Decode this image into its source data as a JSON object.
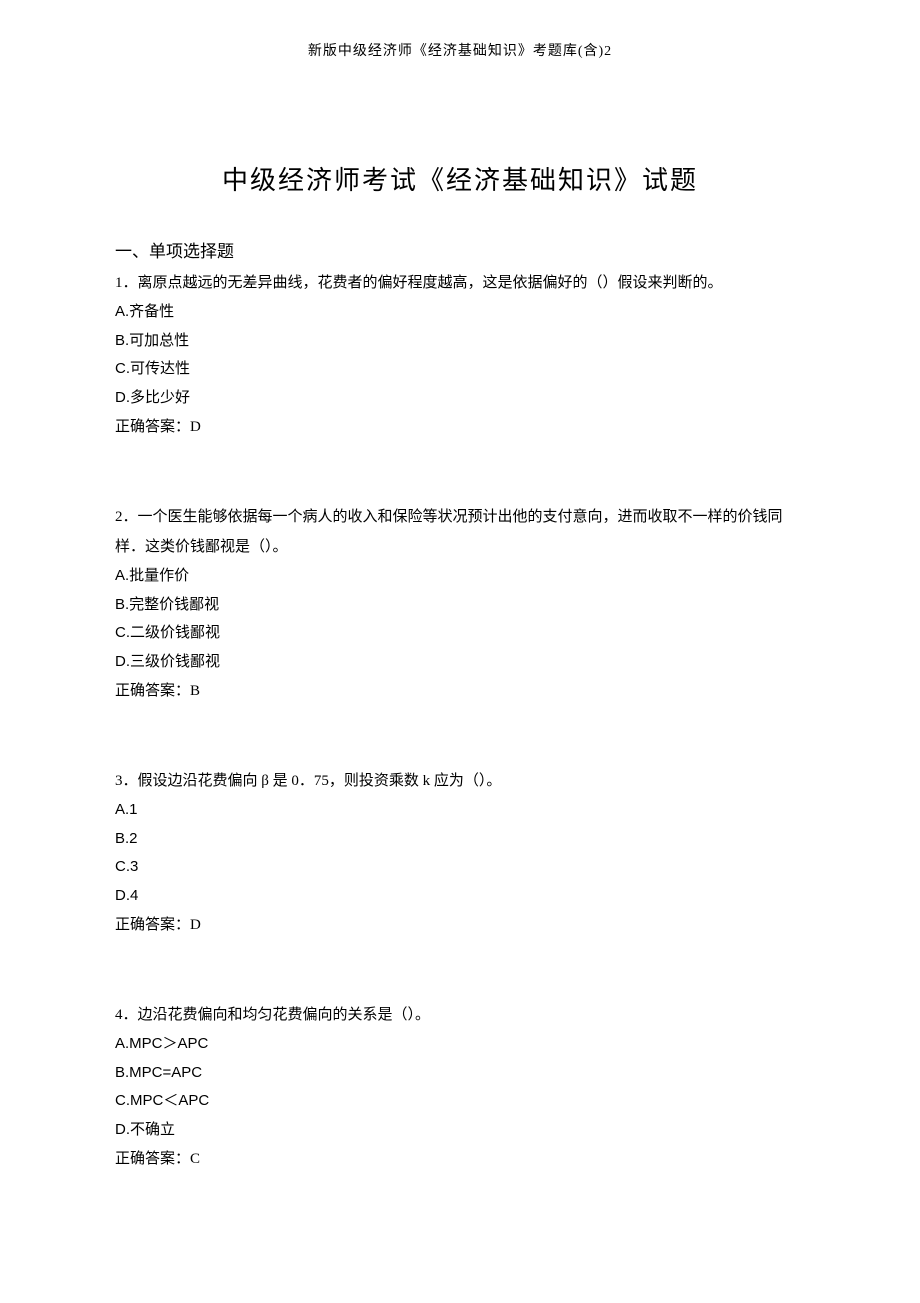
{
  "header": "新版中级经济师《经济基础知识》考题库(含)2",
  "title": "中级经济师考试《经济基础知识》试题",
  "section_heading": "一、单项选择题",
  "questions": [
    {
      "text": "1．离原点越远的无差异曲线，花费者的偏好程度越高，这是依据偏好的（）假设来判断的。",
      "options": [
        "A.齐备性",
        "B.可加总性",
        "C.可传达性",
        "D.多比少好"
      ],
      "answer": "正确答案：D"
    },
    {
      "text": "2．一个医生能够依据每一个病人的收入和保险等状况预计出他的支付意向，进而收取不一样的价钱同样．这类价钱鄙视是（）。",
      "options": [
        "A.批量作价",
        "B.完整价钱鄙视",
        "C.二级价钱鄙视",
        "D.三级价钱鄙视"
      ],
      "answer": "正确答案：B"
    },
    {
      "text": "3．假设边沿花费偏向 β 是 0．75，则投资乘数 k 应为（）。",
      "options": [
        "A.1",
        "B.2",
        "C.3",
        "D.4"
      ],
      "answer": "正确答案：D"
    },
    {
      "text": "4．边沿花费偏向和均匀花费偏向的关系是（）。",
      "options": [
        "A.MPC＞APC",
        "B.MPC=APC",
        "C.MPC＜APC",
        "D.不确立"
      ],
      "answer": "正确答案：C"
    }
  ]
}
